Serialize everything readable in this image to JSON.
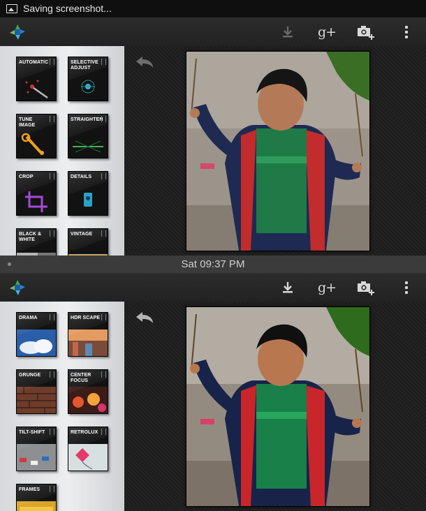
{
  "status_bar": {
    "text": "Saving screenshot..."
  },
  "divider": {
    "time": "Sat 09:37 PM"
  },
  "top": {
    "actionbar": {
      "icons": [
        "download-icon",
        "google-plus-icon",
        "camera-add-icon",
        "overflow-menu-icon"
      ],
      "gplus": "g+"
    },
    "tools": [
      "AUTOMATIC",
      "SELECTIVE ADJUST",
      "TUNE IMAGE",
      "STRAIGHTEN",
      "CROP",
      "DETAILS",
      "BLACK & WHITE",
      "VINTAGE"
    ]
  },
  "bottom": {
    "actionbar": {
      "icons": [
        "download-icon",
        "google-plus-icon",
        "camera-add-icon",
        "overflow-menu-icon"
      ],
      "gplus": "g+"
    },
    "tools": [
      "DRAMA",
      "HDR SCAPE",
      "GRUNGE",
      "CENTER FOCUS",
      "TILT-SHIFT",
      "RETROLUX",
      "FRAMES"
    ]
  },
  "colors": {
    "sidebar": "#e3e5e8",
    "tile": "#121212",
    "actionbar": "#262626",
    "status": "#0f0f0f",
    "divider": "#3b3b3b"
  }
}
